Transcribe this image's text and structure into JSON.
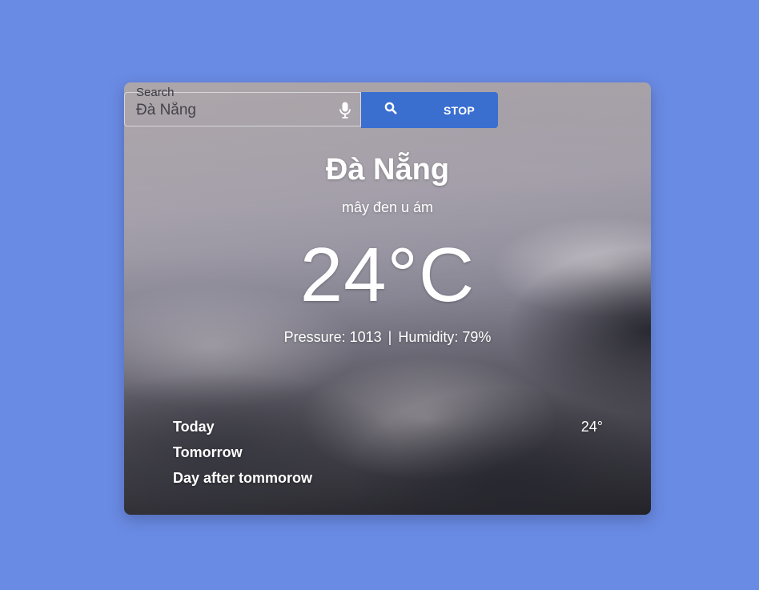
{
  "search": {
    "legend": "Search",
    "value": "Đà Nẵng",
    "mic_icon": "mic-icon",
    "search_icon": "search-icon",
    "stop_label": "STOP"
  },
  "weather": {
    "city": "Đà Nẵng",
    "description": "mây đen u ám",
    "temperature": "24°C",
    "pressure": "Pressure: 1013",
    "separator": "|",
    "humidity": "Humidity: 79%"
  },
  "forecast": [
    {
      "day": "Today",
      "temp": "24°"
    },
    {
      "day": "Tomorrow",
      "temp": ""
    },
    {
      "day": "Day after tommorow",
      "temp": ""
    }
  ],
  "colors": {
    "page_background": "#6a8be4",
    "button_blue": "#3a6fd0",
    "text": "#ffffff"
  }
}
